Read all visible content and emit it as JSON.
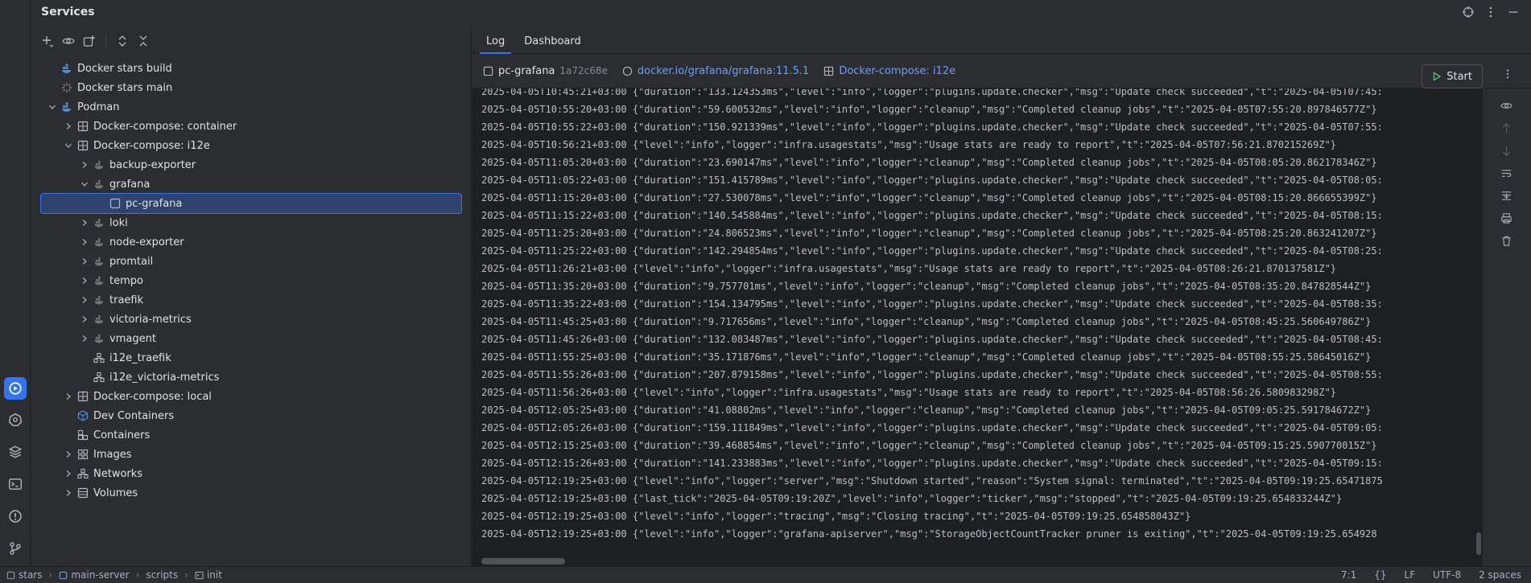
{
  "panel": {
    "title": "Services"
  },
  "tree": {
    "items": [
      {
        "label": "Docker stars build",
        "sub": "",
        "depth": 0,
        "chevron": "none",
        "icon": "docker-build-icon"
      },
      {
        "label": "Docker stars main",
        "sub": "",
        "depth": 0,
        "chevron": "none",
        "icon": "loading-icon"
      },
      {
        "label": "Podman",
        "sub": "",
        "depth": 0,
        "chevron": "down",
        "icon": "podman-icon"
      },
      {
        "label": "Docker-compose: container",
        "sub": "",
        "depth": 1,
        "chevron": "right",
        "icon": "compose-icon"
      },
      {
        "label": "Docker-compose: i12e",
        "sub": "",
        "depth": 1,
        "chevron": "down",
        "icon": "compose-icon"
      },
      {
        "label": "backup-exporter",
        "sub": "",
        "depth": 2,
        "chevron": "right",
        "icon": "service-icon"
      },
      {
        "label": "grafana",
        "sub": "",
        "depth": 2,
        "chevron": "down",
        "icon": "service-icon"
      },
      {
        "label": "pc-grafana",
        "sub": "",
        "depth": 3,
        "chevron": "none",
        "icon": "container-icon",
        "selected": true
      },
      {
        "label": "loki",
        "sub": "",
        "depth": 2,
        "chevron": "right",
        "icon": "service-icon"
      },
      {
        "label": "node-exporter",
        "sub": "",
        "depth": 2,
        "chevron": "right",
        "icon": "service-icon"
      },
      {
        "label": "promtail",
        "sub": "",
        "depth": 2,
        "chevron": "right",
        "icon": "service-icon"
      },
      {
        "label": "tempo",
        "sub": "",
        "depth": 2,
        "chevron": "right",
        "icon": "service-icon"
      },
      {
        "label": "traefik",
        "sub": "",
        "depth": 2,
        "chevron": "right",
        "icon": "service-icon"
      },
      {
        "label": "victoria-metrics",
        "sub": "",
        "depth": 2,
        "chevron": "right",
        "icon": "service-icon"
      },
      {
        "label": "vmagent",
        "sub": "",
        "depth": 2,
        "chevron": "right",
        "icon": "service-icon"
      },
      {
        "label": "i12e_traefik",
        "sub": "",
        "depth": 2,
        "chevron": "none",
        "icon": "network-icon"
      },
      {
        "label": "i12e_victoria-metrics",
        "sub": "",
        "depth": 2,
        "chevron": "none",
        "icon": "network-icon"
      },
      {
        "label": "Docker-compose: local",
        "sub": "",
        "depth": 1,
        "chevron": "right",
        "icon": "compose-icon"
      },
      {
        "label": "Dev Containers",
        "sub": "",
        "depth": 1,
        "chevron": "none",
        "icon": "dev-containers-icon"
      },
      {
        "label": "Containers",
        "sub": "",
        "depth": 1,
        "chevron": "none",
        "icon": "containers-icon"
      },
      {
        "label": "Images",
        "sub": "",
        "depth": 1,
        "chevron": "right",
        "icon": "images-icon"
      },
      {
        "label": "Networks",
        "sub": "",
        "depth": 1,
        "chevron": "right",
        "icon": "network-icon"
      },
      {
        "label": "Volumes",
        "sub": "",
        "depth": 1,
        "chevron": "right",
        "icon": "volumes-icon"
      }
    ]
  },
  "tabs": [
    {
      "label": "Log",
      "active": true
    },
    {
      "label": "Dashboard",
      "active": false
    }
  ],
  "container_bar": {
    "name": "pc-grafana",
    "hash": "1a72c68e",
    "image": "docker.io/grafana/grafana:11.5.1",
    "compose": "Docker-compose: i12e",
    "start_label": "Start"
  },
  "log": {
    "lines": [
      "2025-04-05T10:45:21+03:00 {\"duration\":\"133.124353ms\",\"level\":\"info\",\"logger\":\"plugins.update.checker\",\"msg\":\"Update check succeeded\",\"t\":\"2025-04-05T07:45:",
      "2025-04-05T10:55:20+03:00 {\"duration\":\"59.600532ms\",\"level\":\"info\",\"logger\":\"cleanup\",\"msg\":\"Completed cleanup jobs\",\"t\":\"2025-04-05T07:55:20.897846577Z\"}",
      "2025-04-05T10:55:22+03:00 {\"duration\":\"150.921339ms\",\"level\":\"info\",\"logger\":\"plugins.update.checker\",\"msg\":\"Update check succeeded\",\"t\":\"2025-04-05T07:55:",
      "2025-04-05T10:56:21+03:00 {\"level\":\"info\",\"logger\":\"infra.usagestats\",\"msg\":\"Usage stats are ready to report\",\"t\":\"2025-04-05T07:56:21.870215269Z\"}",
      "2025-04-05T11:05:20+03:00 {\"duration\":\"23.690147ms\",\"level\":\"info\",\"logger\":\"cleanup\",\"msg\":\"Completed cleanup jobs\",\"t\":\"2025-04-05T08:05:20.862178346Z\"}",
      "2025-04-05T11:05:22+03:00 {\"duration\":\"151.415789ms\",\"level\":\"info\",\"logger\":\"plugins.update.checker\",\"msg\":\"Update check succeeded\",\"t\":\"2025-04-05T08:05:",
      "2025-04-05T11:15:20+03:00 {\"duration\":\"27.530078ms\",\"level\":\"info\",\"logger\":\"cleanup\",\"msg\":\"Completed cleanup jobs\",\"t\":\"2025-04-05T08:15:20.866655399Z\"}",
      "2025-04-05T11:15:22+03:00 {\"duration\":\"140.545884ms\",\"level\":\"info\",\"logger\":\"plugins.update.checker\",\"msg\":\"Update check succeeded\",\"t\":\"2025-04-05T08:15:",
      "2025-04-05T11:25:20+03:00 {\"duration\":\"24.806523ms\",\"level\":\"info\",\"logger\":\"cleanup\",\"msg\":\"Completed cleanup jobs\",\"t\":\"2025-04-05T08:25:20.863241207Z\"}",
      "2025-04-05T11:25:22+03:00 {\"duration\":\"142.294854ms\",\"level\":\"info\",\"logger\":\"plugins.update.checker\",\"msg\":\"Update check succeeded\",\"t\":\"2025-04-05T08:25:",
      "2025-04-05T11:26:21+03:00 {\"level\":\"info\",\"logger\":\"infra.usagestats\",\"msg\":\"Usage stats are ready to report\",\"t\":\"2025-04-05T08:26:21.870137581Z\"}",
      "2025-04-05T11:35:20+03:00 {\"duration\":\"9.757701ms\",\"level\":\"info\",\"logger\":\"cleanup\",\"msg\":\"Completed cleanup jobs\",\"t\":\"2025-04-05T08:35:20.847828544Z\"}",
      "2025-04-05T11:35:22+03:00 {\"duration\":\"154.134795ms\",\"level\":\"info\",\"logger\":\"plugins.update.checker\",\"msg\":\"Update check succeeded\",\"t\":\"2025-04-05T08:35:",
      "2025-04-05T11:45:25+03:00 {\"duration\":\"9.717656ms\",\"level\":\"info\",\"logger\":\"cleanup\",\"msg\":\"Completed cleanup jobs\",\"t\":\"2025-04-05T08:45:25.560649786Z\"}",
      "2025-04-05T11:45:26+03:00 {\"duration\":\"132.083487ms\",\"level\":\"info\",\"logger\":\"plugins.update.checker\",\"msg\":\"Update check succeeded\",\"t\":\"2025-04-05T08:45:",
      "2025-04-05T11:55:25+03:00 {\"duration\":\"35.171876ms\",\"level\":\"info\",\"logger\":\"cleanup\",\"msg\":\"Completed cleanup jobs\",\"t\":\"2025-04-05T08:55:25.58645016Z\"}",
      "2025-04-05T11:55:26+03:00 {\"duration\":\"207.879158ms\",\"level\":\"info\",\"logger\":\"plugins.update.checker\",\"msg\":\"Update check succeeded\",\"t\":\"2025-04-05T08:55:",
      "2025-04-05T11:56:26+03:00 {\"level\":\"info\",\"logger\":\"infra.usagestats\",\"msg\":\"Usage stats are ready to report\",\"t\":\"2025-04-05T08:56:26.580983298Z\"}",
      "2025-04-05T12:05:25+03:00 {\"duration\":\"41.08802ms\",\"level\":\"info\",\"logger\":\"cleanup\",\"msg\":\"Completed cleanup jobs\",\"t\":\"2025-04-05T09:05:25.591784672Z\"}",
      "2025-04-05T12:05:26+03:00 {\"duration\":\"159.111849ms\",\"level\":\"info\",\"logger\":\"plugins.update.checker\",\"msg\":\"Update check succeeded\",\"t\":\"2025-04-05T09:05:",
      "2025-04-05T12:15:25+03:00 {\"duration\":\"39.468854ms\",\"level\":\"info\",\"logger\":\"cleanup\",\"msg\":\"Completed cleanup jobs\",\"t\":\"2025-04-05T09:15:25.590770015Z\"}",
      "2025-04-05T12:15:26+03:00 {\"duration\":\"141.233883ms\",\"level\":\"info\",\"logger\":\"plugins.update.checker\",\"msg\":\"Update check succeeded\",\"t\":\"2025-04-05T09:15:",
      "2025-04-05T12:19:25+03:00 {\"level\":\"info\",\"logger\":\"server\",\"msg\":\"Shutdown started\",\"reason\":\"System signal: terminated\",\"t\":\"2025-04-05T09:19:25.65471875",
      "2025-04-05T12:19:25+03:00 {\"last_tick\":\"2025-04-05T09:19:20Z\",\"level\":\"info\",\"logger\":\"ticker\",\"msg\":\"stopped\",\"t\":\"2025-04-05T09:19:25.654833244Z\"}",
      "2025-04-05T12:19:25+03:00 {\"level\":\"info\",\"logger\":\"tracing\",\"msg\":\"Closing tracing\",\"t\":\"2025-04-05T09:19:25.654858043Z\"}",
      "2025-04-05T12:19:25+03:00 {\"level\":\"info\",\"logger\":\"grafana-apiserver\",\"msg\":\"StorageObjectCountTracker pruner is exiting\",\"t\":\"2025-04-05T09:19:25.654928"
    ]
  },
  "status_bar": {
    "breadcrumbs": [
      "stars",
      "main-server",
      "scripts",
      "init"
    ],
    "position": "7:1",
    "braces": "{}",
    "line_ending": "LF",
    "encoding": "UTF-8",
    "indent": "2 spaces"
  },
  "colors": {
    "accent": "#3574f0",
    "link": "#6f9ef8",
    "run_green": "#5fb865",
    "docker_blue": "#4a8fe0"
  }
}
